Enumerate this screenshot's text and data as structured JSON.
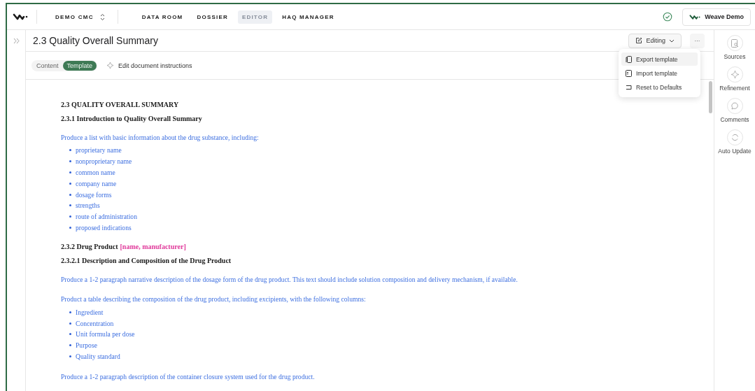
{
  "nav": {
    "project": "DEMO CMC",
    "tabs": [
      {
        "label": "DATA ROOM",
        "selected": false
      },
      {
        "label": "DOSSIER",
        "selected": false
      },
      {
        "label": "EDITOR",
        "selected": true
      },
      {
        "label": "HAQ MANAGER",
        "selected": false
      }
    ],
    "account": "Weave Demo"
  },
  "header": {
    "title": "2.3 Quality Overall Summary",
    "mode": "Editing",
    "more": "···"
  },
  "menu": [
    {
      "label": "Export template",
      "kind": "export",
      "selected": true
    },
    {
      "label": "Import template",
      "kind": "import",
      "selected": false
    },
    {
      "label": "Reset to Defaults",
      "kind": "reset",
      "selected": false
    }
  ],
  "view_tabs": [
    {
      "label": "Content",
      "selected": false
    },
    {
      "label": "Template",
      "selected": true
    }
  ],
  "instructions_link": "Edit document instructions",
  "side_panel": [
    {
      "label": "Sources",
      "kind": "sources"
    },
    {
      "label": "Refinement",
      "kind": "refinement"
    },
    {
      "label": "Comments",
      "kind": "comments"
    },
    {
      "label": "Auto Update",
      "kind": "update"
    }
  ],
  "document": [
    {
      "kind": "heading",
      "text": "2.3 QUALITY OVERALL SUMMARY"
    },
    {
      "kind": "heading",
      "text": "2.3.1 Introduction to Quality Overall Summary"
    },
    {
      "kind": "paragraph",
      "text": "Produce a list with basic information about the drug substance, including:"
    },
    {
      "kind": "list",
      "items": [
        "proprietary name",
        "nonproprietary name",
        "common name",
        "company name",
        "dosage forms",
        "strengths",
        "route of administration",
        "proposed indications"
      ]
    },
    {
      "kind": "heading",
      "text": "2.3.2 Drug Product",
      "tag": "[name, manufacturer]"
    },
    {
      "kind": "heading",
      "text": "2.3.2.1 Description and Composition of the Drug Product"
    },
    {
      "kind": "paragraph",
      "text": "Produce a 1-2 paragraph narrative description of the dosage form of the drug product.  This text should include solution composition and delivery mechanism, if available."
    },
    {
      "kind": "paragraph",
      "text": "Product a table describing the composition of the drug product, including excipients, with the following columns:"
    },
    {
      "kind": "list",
      "items": [
        "Ingredient",
        "Concentration",
        "Unit formula per dose",
        "Purpose",
        "Quality standard"
      ]
    },
    {
      "kind": "paragraph",
      "text": "Produce a 1-2 paragraph description of the container closure system used for the drug product."
    }
  ]
}
